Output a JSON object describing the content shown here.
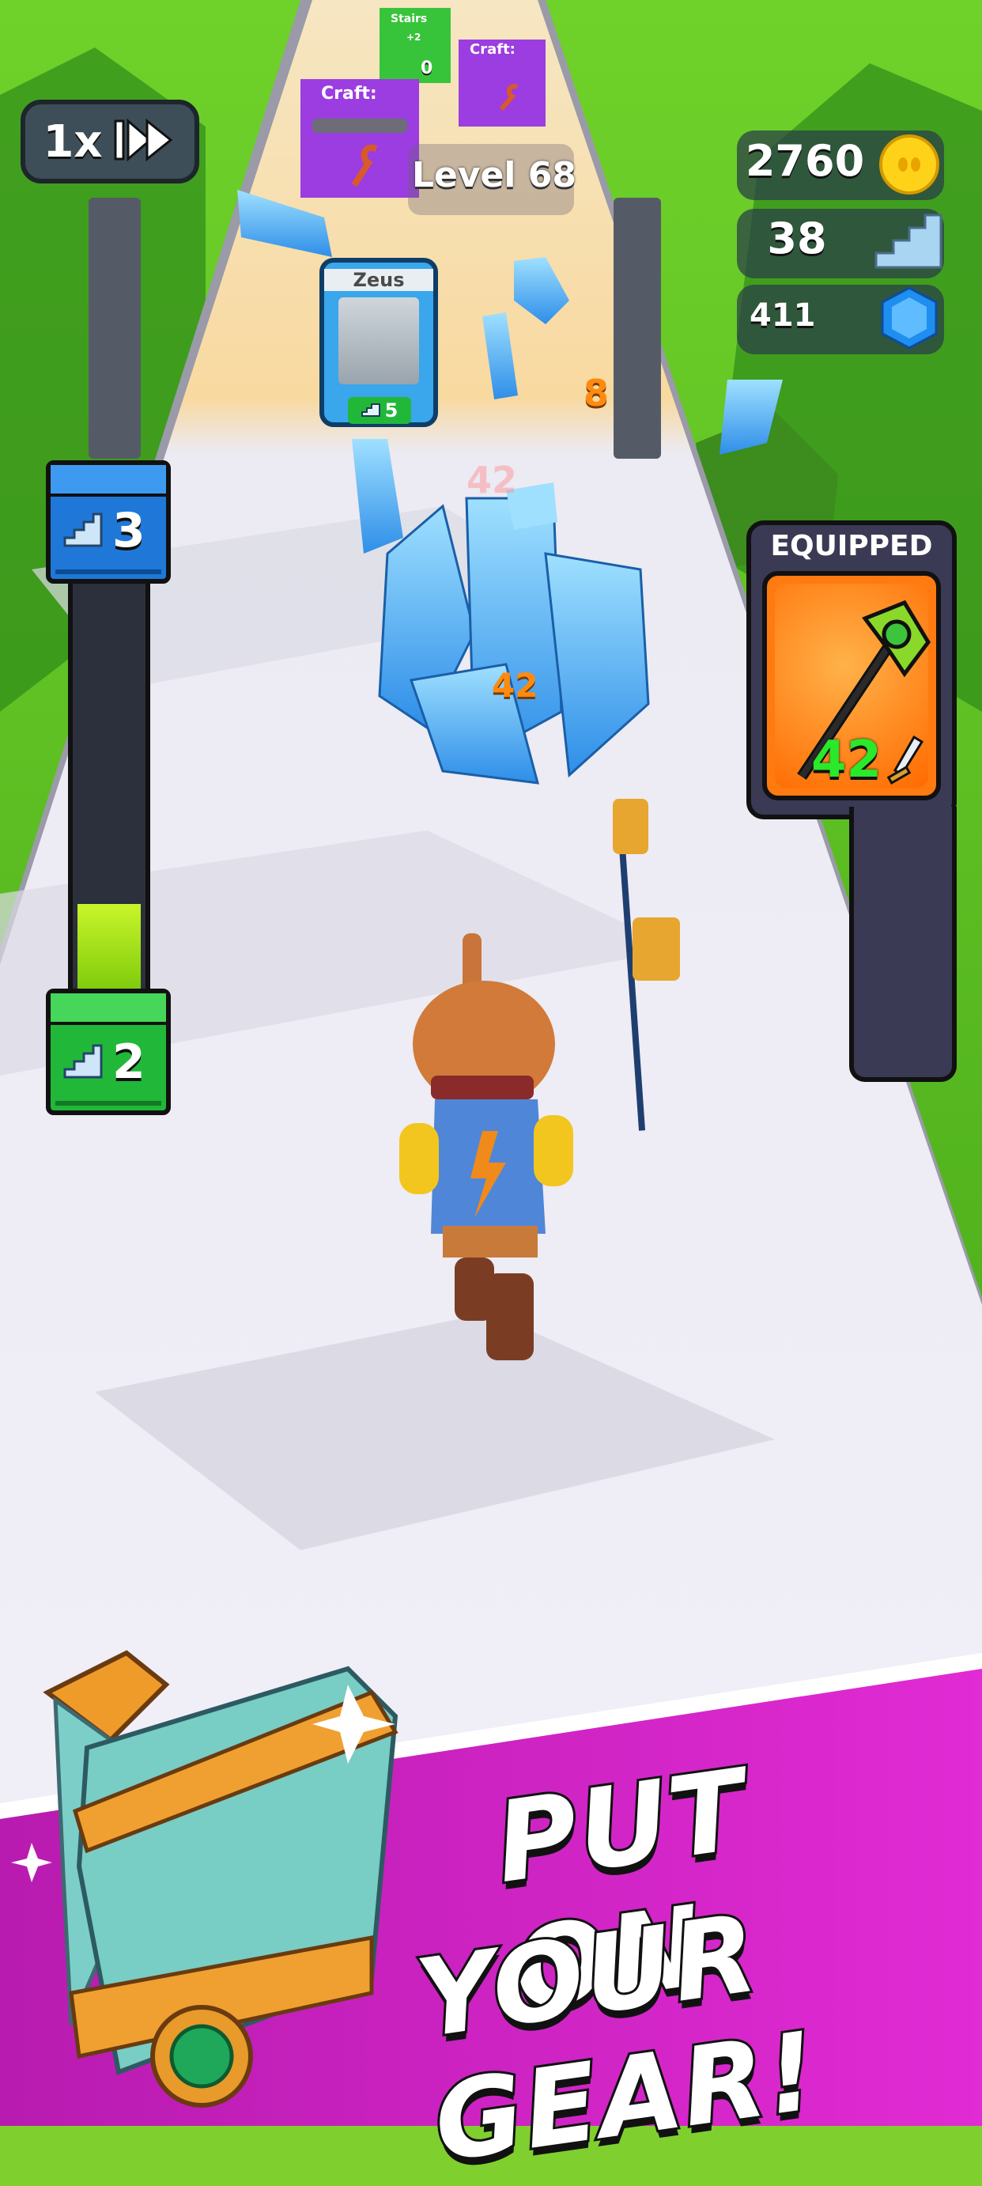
{
  "hud": {
    "speed_label": "1x",
    "level_label": "Level 68",
    "coins": "2760",
    "stairs": "38",
    "gems": "411"
  },
  "progress_bar": {
    "top_value": "3",
    "bottom_value": "2",
    "fill_fraction": 0.22
  },
  "equipped": {
    "title": "EQUIPPED",
    "power": "42"
  },
  "track": {
    "zeus_card": {
      "name": "Zeus",
      "cost": "5"
    },
    "gate_stairs": {
      "label": "Stairs",
      "value": "+2",
      "count": "0"
    },
    "gate_craft_left": {
      "label": "Craft:"
    },
    "gate_craft_right": {
      "label": "Craft:"
    },
    "crystal_hp": "42",
    "crystal_ghost_hp": "42",
    "floating_number": "8"
  },
  "banner": {
    "line1": "PUT ON",
    "line2": "YOUR GEAR!"
  },
  "colors": {
    "accent_orange": "#ff7a10",
    "bar_fill": "#a4e81a",
    "banner_magenta": "#d21fc8"
  }
}
